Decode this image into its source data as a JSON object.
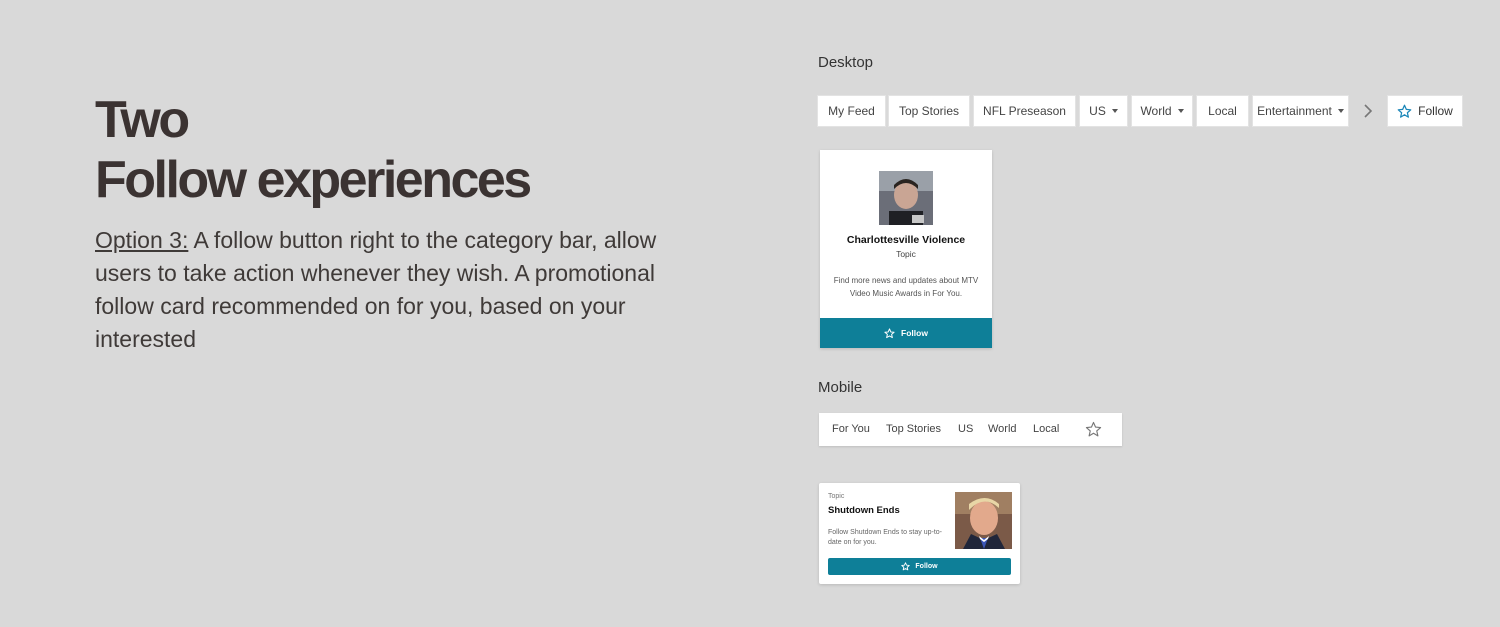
{
  "heading": {
    "line1": "Two",
    "line2": "Follow experiences"
  },
  "description": {
    "option_label": "Option 3:",
    "text": " A follow button right to the category bar, allow users to take action whenever they wish. A promotional follow card recommended on for you, based on your interested"
  },
  "desktop": {
    "label": "Desktop",
    "tabs": [
      {
        "label": "My Feed"
      },
      {
        "label": "Top Stories"
      },
      {
        "label": "NFL Preseason"
      },
      {
        "label": "US"
      },
      {
        "label": "World"
      },
      {
        "label": "Local"
      },
      {
        "label": "Entertainment"
      }
    ],
    "next_icon": "chevron-right-icon",
    "follow_label": "Follow",
    "card": {
      "title": "Charlottesville Violence",
      "subtitle": "Topic",
      "text": "Find more news and updates about MTV Video Music Awards in For You.",
      "button_label": "Follow"
    }
  },
  "mobile": {
    "label": "Mobile",
    "tabs": [
      {
        "label": "For You"
      },
      {
        "label": "Top Stories"
      },
      {
        "label": "US"
      },
      {
        "label": "World"
      },
      {
        "label": "Local"
      }
    ],
    "follow_icon": "star-icon",
    "card": {
      "topic": "Topic",
      "title": "Shutdown Ends",
      "text": "Follow Shutdown Ends to stay up-to-date on for you.",
      "button_label": "Follow"
    }
  },
  "colors": {
    "background": "#d9d9d9",
    "accent": "#0e7f98",
    "star_outline": "#1a86b8"
  }
}
